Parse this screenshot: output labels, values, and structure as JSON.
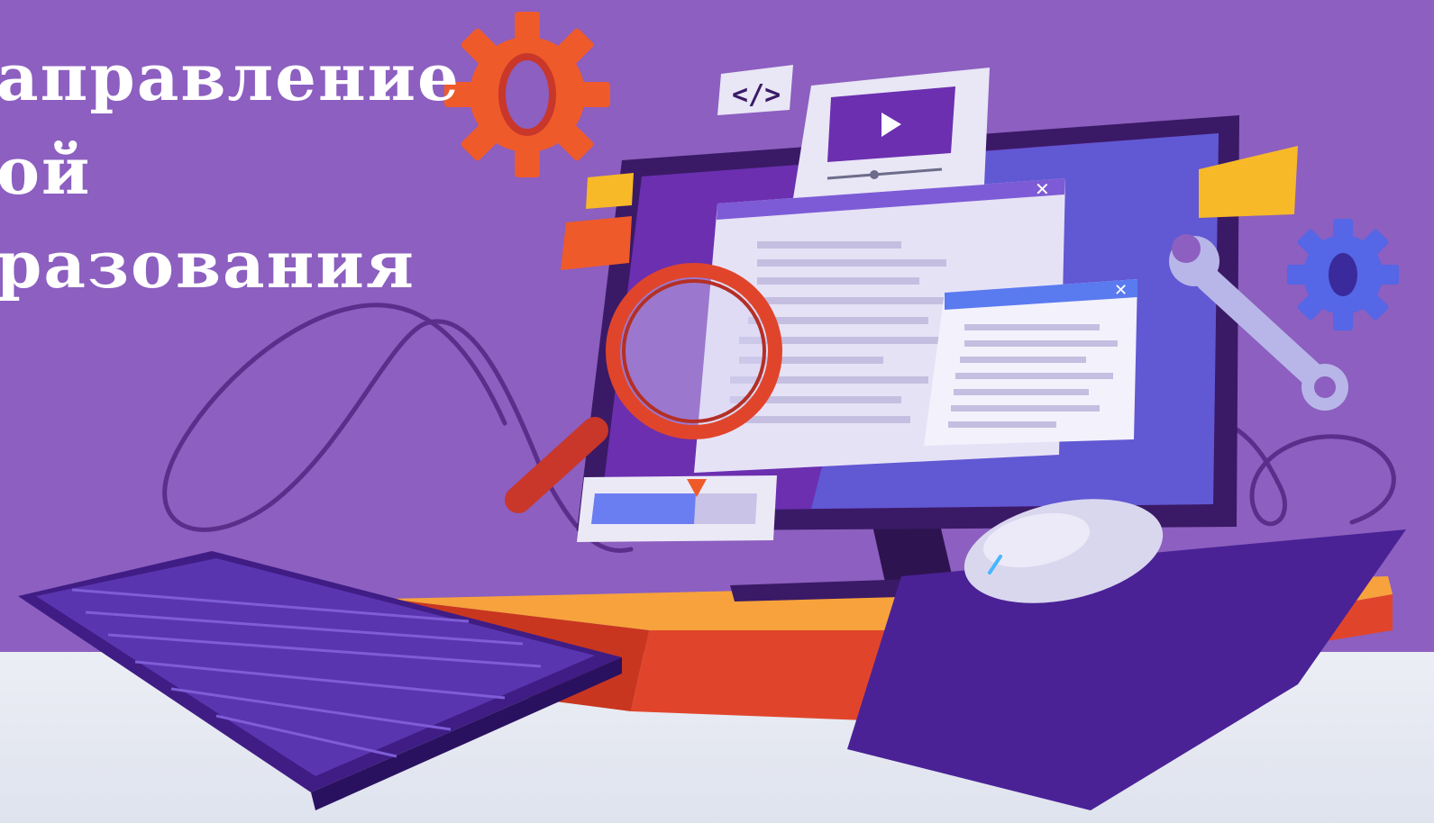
{
  "banner": {
    "heading_lines": [
      "аправление",
      "ой",
      "разования"
    ]
  },
  "icons": {
    "code_badge": "code-brackets-icon",
    "video_panel": "play-icon",
    "magnifier": "magnifier-icon",
    "gears": "gear-icon",
    "wrench": "wrench-icon",
    "close": "close-icon"
  },
  "colors": {
    "background": "#8c5fc0",
    "floor": "#e6e9f2",
    "heading_text": "#ffffff",
    "gear_orange": "#ef5a2a",
    "gear_blue": "#5566e6",
    "desk_top": "#f7a23c",
    "desk_front": "#e0452b",
    "monitor": "#3a1a66",
    "screen": "#6b2fb0",
    "accent_yellow": "#f7b928"
  }
}
